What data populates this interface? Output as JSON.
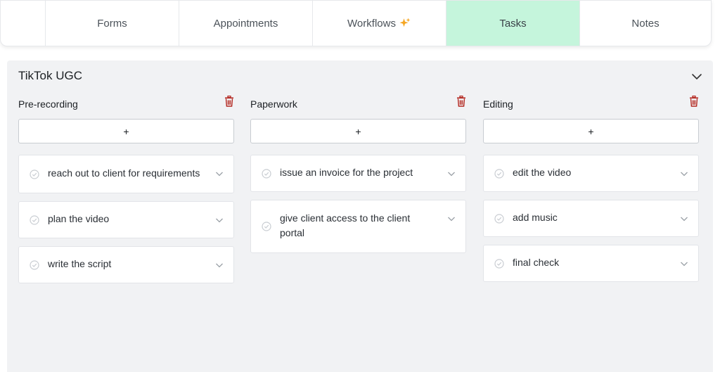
{
  "tabs": [
    {
      "label": "Forms",
      "active": false
    },
    {
      "label": "Appointments",
      "active": false
    },
    {
      "label": "Workflows",
      "active": false,
      "icon": "sparkle-icon"
    },
    {
      "label": "Tasks",
      "active": true
    },
    {
      "label": "Notes",
      "active": false
    }
  ],
  "colors": {
    "active_tab_bg": "#c5f5dc",
    "panel_bg": "#f1f2f4",
    "sparkle": "#f5a623",
    "trash": "#b3261e"
  },
  "board": {
    "title": "TikTok UGC",
    "add_label": "+",
    "columns": [
      {
        "title": "Pre-recording",
        "cards": [
          {
            "text": "reach out to client for requirements"
          },
          {
            "text": "plan the video"
          },
          {
            "text": "write the script"
          }
        ]
      },
      {
        "title": "Paperwork",
        "cards": [
          {
            "text": "issue an invoice for the project"
          },
          {
            "text": "give client access to the client portal"
          }
        ]
      },
      {
        "title": "Editing",
        "cards": [
          {
            "text": "edit the video"
          },
          {
            "text": "add music"
          },
          {
            "text": "final check"
          }
        ]
      }
    ]
  }
}
